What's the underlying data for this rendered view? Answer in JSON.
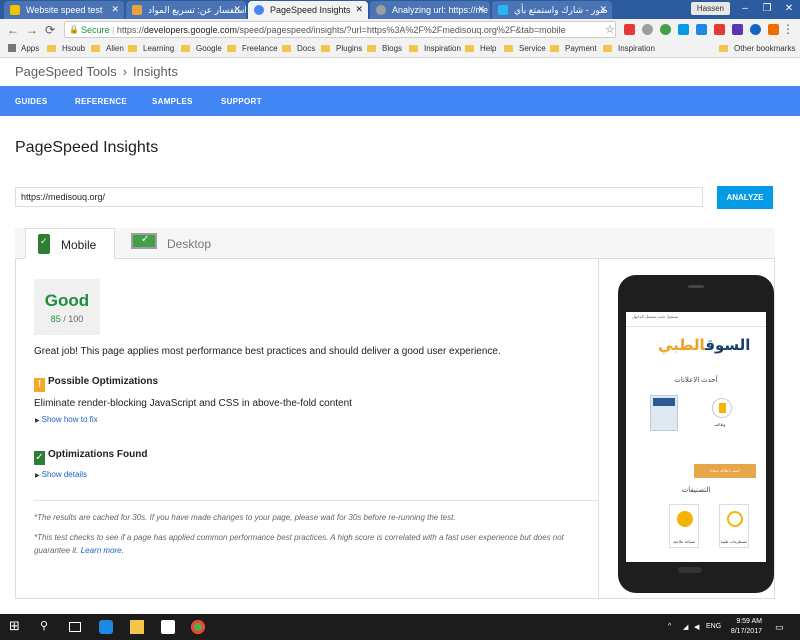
{
  "browser": {
    "tabs": [
      {
        "title": "Website speed test",
        "favicon_color": "#f5c400",
        "active": false
      },
      {
        "title": "استفسار عن: تسريع المواد",
        "favicon_color": "#e9a23b",
        "active": false
      },
      {
        "title": "PageSpeed Insights",
        "favicon_color": "#4285f4",
        "active": true
      },
      {
        "title": "Analyzing url: https://me",
        "favicon_color": "#9e9e9e",
        "active": false
      },
      {
        "title": "صور - شارك واستمتع بأي",
        "favicon_color": "#29b6f6",
        "active": false
      }
    ],
    "user": "Hassen",
    "window_controls": [
      "–",
      "❐",
      "✕"
    ],
    "nav": {
      "back": "←",
      "forward": "→",
      "reload": "⟳"
    },
    "omnibox": {
      "secure_label": "Secure",
      "url_prefix": "https://",
      "url_host": "developers.google.com",
      "url_rest": "/speed/pagespeed/insights/?url=https%3A%2F%2Fmedisouq.org%2F&tab=mobile"
    },
    "bookmarks": [
      "Apps",
      "Hsoub",
      "Alien",
      "Learning",
      "Google",
      "Freelance",
      "Docs",
      "Plugins",
      "Blogs",
      "Inspiration",
      "Help",
      "Service",
      "Payment",
      "Inspiration"
    ],
    "other_bookmarks": "Other bookmarks"
  },
  "page": {
    "breadcrumb": [
      "PageSpeed Tools",
      "Insights"
    ],
    "nav": [
      "GUIDES",
      "REFERENCE",
      "SAMPLES",
      "SUPPORT"
    ],
    "title": "PageSpeed Insights",
    "url_value": "https://medisouq.org/",
    "analyze_label": "ANALYZE",
    "tabs": [
      {
        "label": "Mobile",
        "active": true
      },
      {
        "label": "Desktop",
        "active": false
      }
    ],
    "score": {
      "label": "Good",
      "value": "85",
      "max": "/ 100",
      "color": "#1e8e3e"
    },
    "summary": "Great job! This page applies most performance best practices and should deliver a good user experience.",
    "possible": {
      "heading": "Possible Optimizations",
      "rule": "Eliminate render-blocking JavaScript and CSS in above-the-fold content",
      "toggle": "Show how to fix"
    },
    "found": {
      "heading": "Optimizations Found",
      "toggle": "Show details"
    },
    "notes": {
      "cached": "*The results are cached for 30s. If you have made changes to your page, please wait for 30s before re-running the test.",
      "disclaimer": "*This test checks to see if a page has applied common performance best practices. A high score is correlated with a fast user experience but does not guarantee it.",
      "learn_more": "Learn more."
    }
  },
  "preview": {
    "top_links": "تسجيل جديد    تسجيل الدخول",
    "logo_main": "السوق",
    "logo_accent": "الطبي",
    "latest_ads": "أحدث الاعلانات",
    "cert_label": "وظائف",
    "button": "أضف اعلانك مجانا",
    "categories": "التصنيفات",
    "cards": [
      "سياحة علاجية",
      "مستلزمات طبية"
    ]
  },
  "taskbar": {
    "time": "9:59 AM",
    "date": "8/17/2017",
    "lang": "ENG"
  }
}
